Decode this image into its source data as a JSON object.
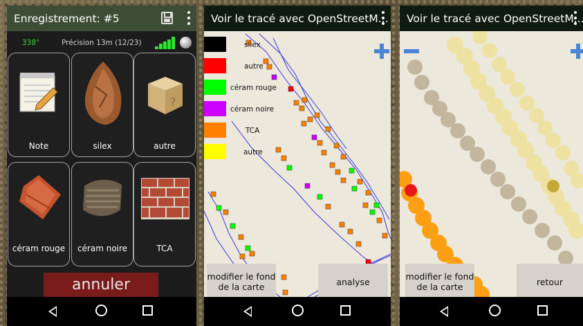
{
  "screen1": {
    "title": "Enregistrement: #5",
    "heading_deg": "338°",
    "precision": "Précision 13m (12/23)",
    "tiles": [
      {
        "label": "Note"
      },
      {
        "label": "silex"
      },
      {
        "label": "autre"
      },
      {
        "label": "céram rouge"
      },
      {
        "label": "céram noire"
      },
      {
        "label": "TCA"
      }
    ],
    "cancel_label": "annuler",
    "icons": {
      "save": "save-icon",
      "menu": "more-vert-icon",
      "signal": "signal-bars-icon",
      "gps": "gps-status-icon"
    }
  },
  "screen2": {
    "title": "Voir le tracé avec OpenStreetM...",
    "legend": [
      {
        "label": "silex",
        "color": "#000000"
      },
      {
        "label": "autre",
        "color": "#ff0000"
      },
      {
        "label": "céram rouge",
        "color": "#00ff00"
      },
      {
        "label": "céram noire",
        "color": "#cc00ff"
      },
      {
        "label": "TCA",
        "color": "#ff7f00"
      },
      {
        "label": "autre",
        "color": "#ffff00"
      }
    ],
    "btn_left": "modifier le fond de la carte",
    "btn_right": "analyse"
  },
  "screen3": {
    "title": "Voir le tracé avec OpenStreetM...",
    "btn_left": "modifier le fond de la carte",
    "btn_right": "retour"
  },
  "colors": {
    "accent_bar": "#3d4d35",
    "cancel": "#7a1b1b",
    "zoom": "#4a86d6"
  }
}
